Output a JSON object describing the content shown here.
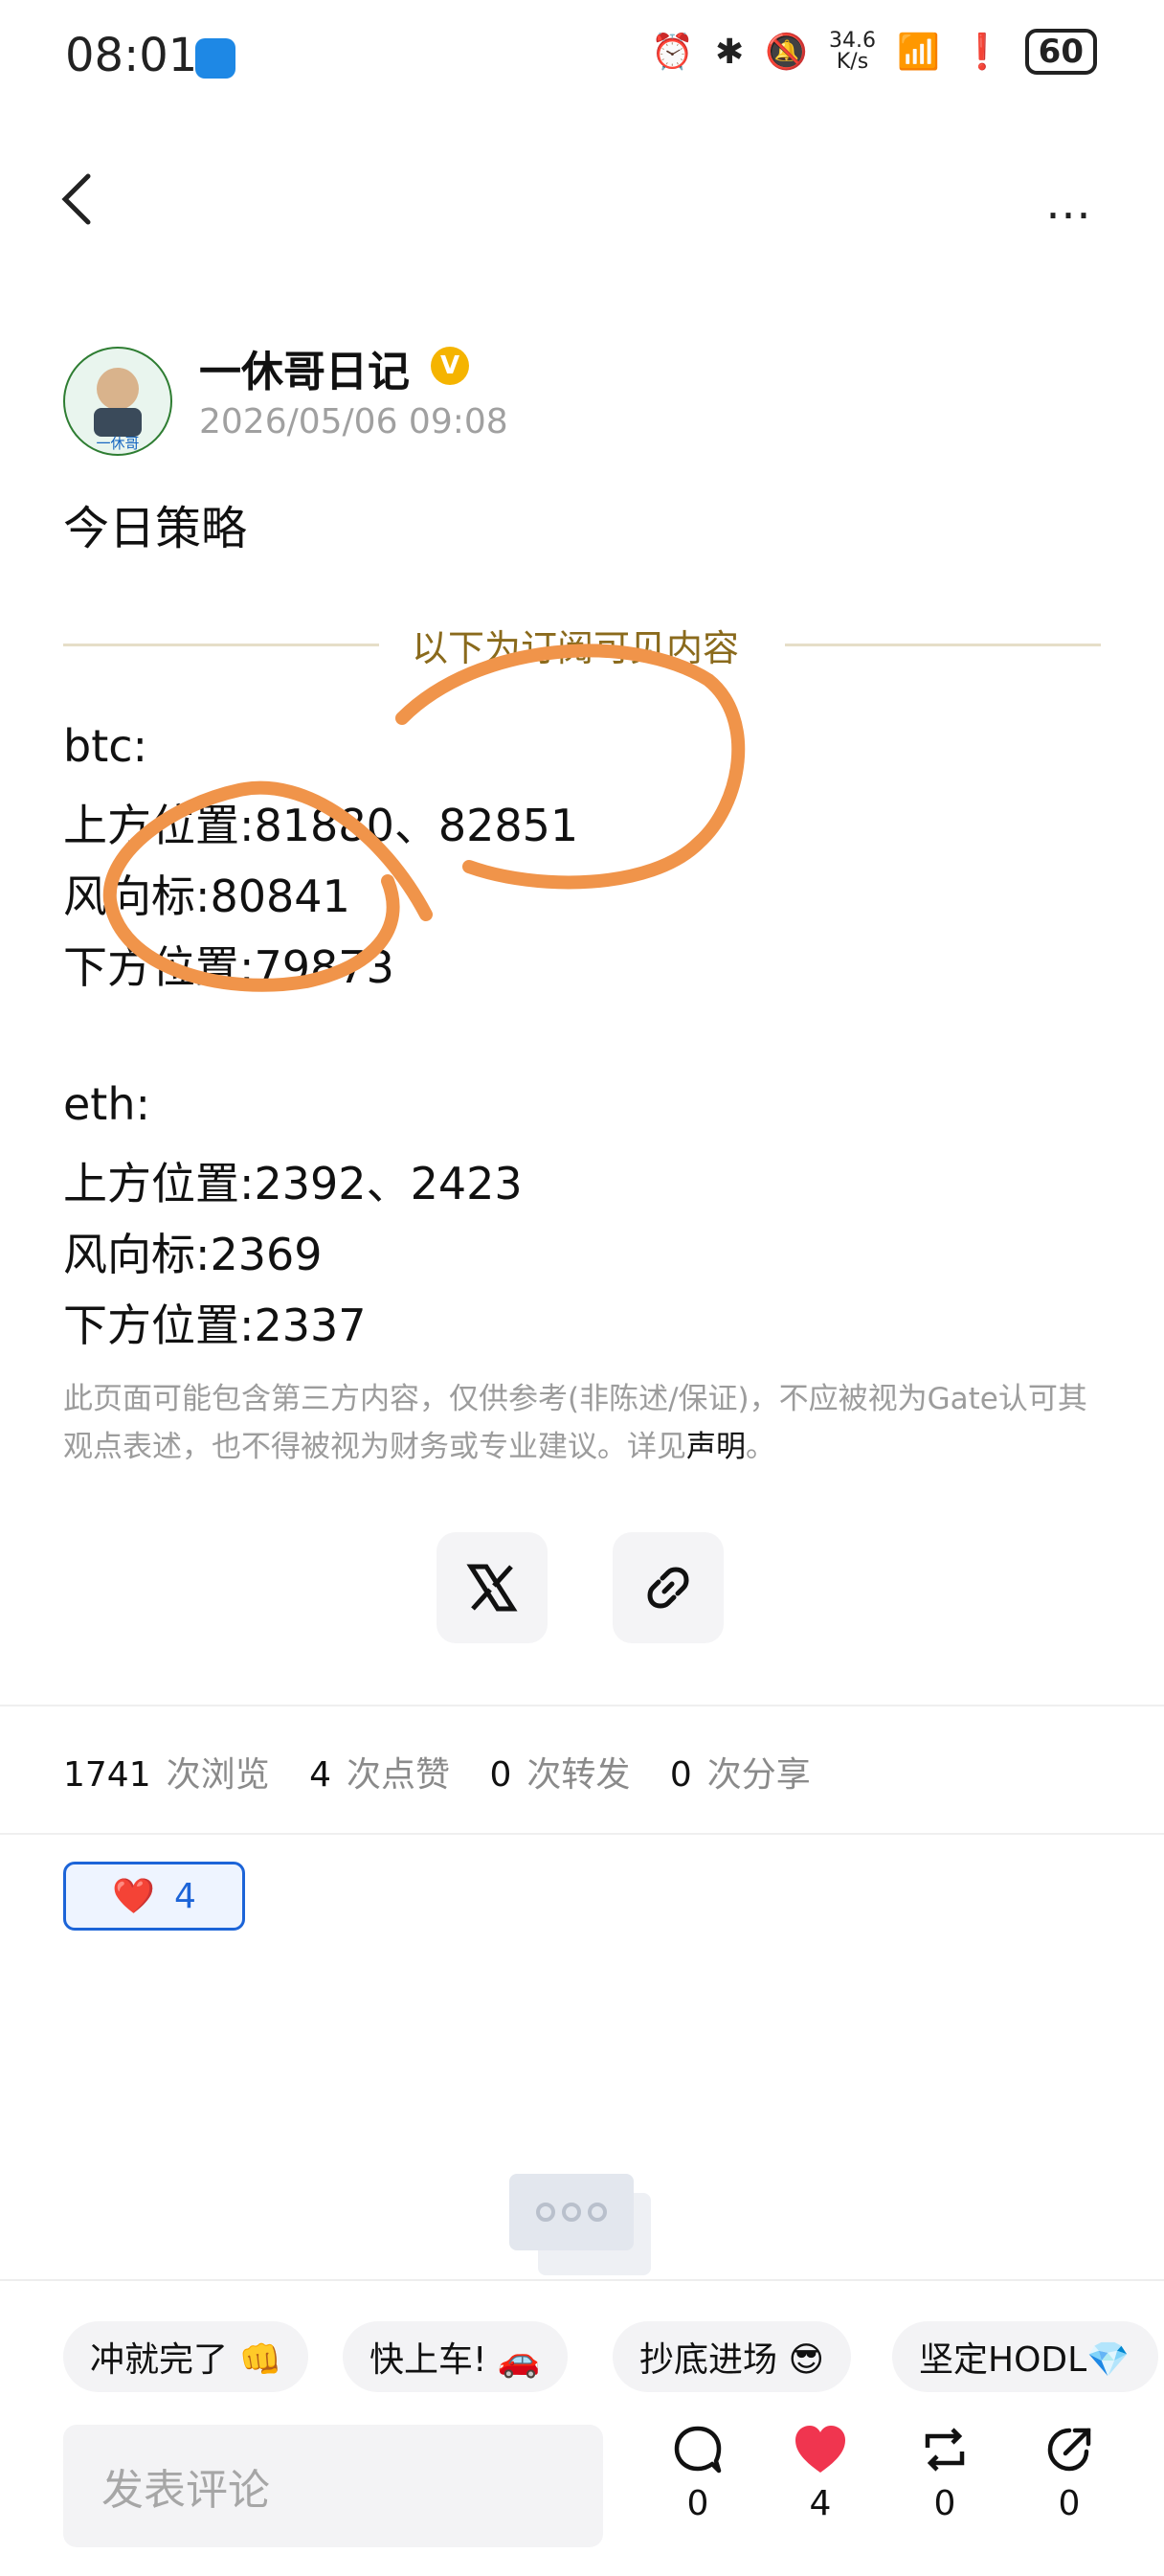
{
  "status_bar": {
    "time": "08:01",
    "speed_value": "34.6",
    "speed_unit": "K/s",
    "battery": "60"
  },
  "author": {
    "name": "一休哥日记",
    "avatar_caption": "一休哥",
    "date": "2026/05/06 09:08",
    "verified_badge": "V"
  },
  "post": {
    "headline": "今日策略",
    "divider_text": "以下为订阅可见内容",
    "lines": [
      "btc:",
      "上方位置:81880、82851",
      "风向标:80841",
      "下方位置:79873",
      "eth:",
      "上方位置:2392、2423",
      "风向标:2369",
      "下方位置:2337"
    ],
    "disclaimer": "此页面可能包含第三方内容，仅供参考(非陈述/保证)，不应被视为Gate认可其观点表述，也不得被视为财务或专业建议。详见",
    "disclaimer_link": "声明",
    "disclaimer_end": "。"
  },
  "stats": {
    "views": "1741",
    "views_label": "次浏览",
    "likes": "4",
    "likes_label": "次点赞",
    "reposts": "0",
    "reposts_label": "次转发",
    "shares": "0",
    "shares_label": "次分享"
  },
  "reaction": {
    "emoji": "❤️",
    "count": "4"
  },
  "quick_replies": [
    "冲就完了 👊",
    "快上车! 🚗",
    "抄底进场 😎",
    "坚定HODL💎"
  ],
  "comment_placeholder": "发表评论",
  "actions": {
    "comment": "0",
    "like": "4",
    "repost": "0",
    "share": "0"
  },
  "colors": {
    "accent_blue": "#1c64d8",
    "divider_gold": "#8a6a1c",
    "like_red": "#f0354f",
    "annotation_orange": "#f0944a"
  }
}
